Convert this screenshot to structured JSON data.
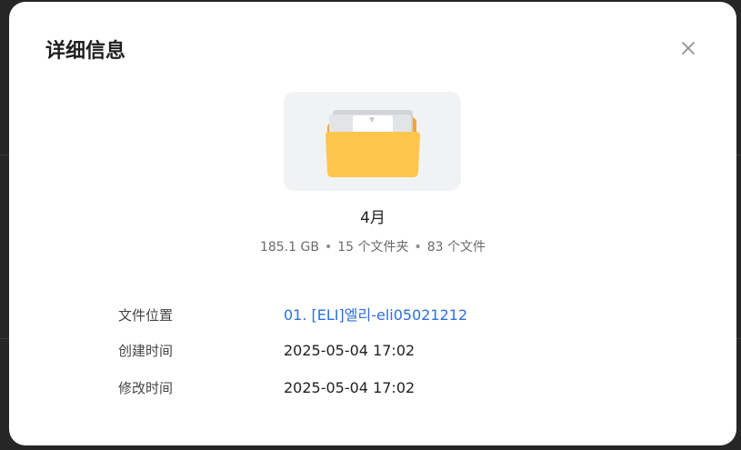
{
  "dialog": {
    "title": "详细信息",
    "close_icon": "close-icon"
  },
  "folder": {
    "icon": "folder-icon",
    "name": "4月",
    "size": "185.1 GB",
    "folder_count": "15 个文件夹",
    "file_count": "83 个文件",
    "separator": "•"
  },
  "details": [
    {
      "label": "文件位置",
      "value": "01. [ELI]엘리-eli05021212",
      "is_link": true
    },
    {
      "label": "创建时间",
      "value": "2025-05-04 17:02",
      "is_link": false
    },
    {
      "label": "修改时间",
      "value": "2025-05-04 17:02",
      "is_link": false
    }
  ],
  "colors": {
    "link": "#2f6fe0",
    "folder_front": "#ffc54d",
    "folder_back": "#f0a531",
    "preview_bg": "#f1f2f4"
  }
}
